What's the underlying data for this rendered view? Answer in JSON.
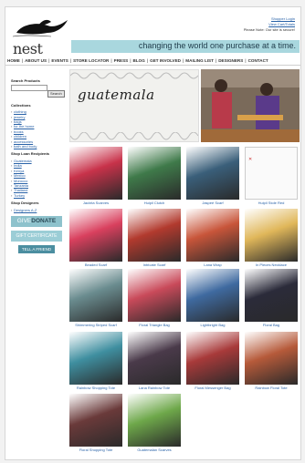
{
  "header": {
    "logo_text": "nest",
    "links": [
      "Shopper Login",
      "View Cart/Totals",
      "Please Note: Our site is secure!"
    ],
    "tagline": "changing the world one purchase at a time."
  },
  "nav": [
    "HOME",
    "ABOUT US",
    "EVENTS",
    "STORE LOCATOR",
    "PRESS",
    "BLOG",
    "GET INVOLVED",
    "MAILING LIST",
    "DESIGNERS",
    "CONTACT"
  ],
  "sidebar": {
    "search_heading": "Search Products",
    "search_button": "Search",
    "collections_heading": "Collections",
    "collections": [
      "clothing",
      "jewelry",
      "bags",
      "for the home",
      "books",
      "children",
      "accessories",
      "bath and body"
    ],
    "recipients_heading": "Shop Loan Recipients",
    "recipients": [
      "Guatemala",
      "India",
      "Kenya",
      "Mexico",
      "Morocco",
      "Tanzania",
      "Thailand",
      "Turkey"
    ],
    "designers_heading": "Shop Designers",
    "designers": [
      "Designers A-Z"
    ],
    "give_label": "GIVE",
    "donate_label": "DONATE",
    "gift_label": "GIFT CERTIFICATE",
    "tell_label": "TELL A FRIEND"
  },
  "banner": {
    "title": "guatemala"
  },
  "products": [
    {
      "name": "Jacinta Scarves",
      "color": "#c8324a"
    },
    {
      "name": "Huipil Clutch",
      "color": "#3f7a4a"
    },
    {
      "name": "Jaspeé Scarf",
      "color": "#3a5f7a"
    },
    {
      "name": "Huipil Stole Red",
      "color": "#f4f4f4"
    },
    {
      "name": "Beaded Scarf",
      "color": "#d9405e"
    },
    {
      "name": "Intricate Scarf",
      "color": "#b23a2e"
    },
    {
      "name": "Lana Wrap",
      "color": "#c8553a"
    },
    {
      "name": "In Pieces Necklace",
      "color": "#e0b75a"
    },
    {
      "name": "Shimmering Striped Scarf",
      "color": "#6a8c8f"
    },
    {
      "name": "Floral Triangle Bag",
      "color": "#c94a5a"
    },
    {
      "name": "Lightbright Bag",
      "color": "#3f6aa0"
    },
    {
      "name": "Floral Bag",
      "color": "#2b2b3a"
    },
    {
      "name": "Rainbow Shopping Tote",
      "color": "#3f8fa0"
    },
    {
      "name": "Lana Rainbow Tote",
      "color": "#4a3a4a"
    },
    {
      "name": "Floral Messenger Bag",
      "color": "#a83a3a"
    },
    {
      "name": "Rainbow Floral Tote",
      "color": "#b65a3a"
    },
    {
      "name": "Floral Shopping Tote",
      "color": "#6a3a3a"
    },
    {
      "name": "Guatemalan Scarves",
      "color": "#6ea84a"
    }
  ]
}
